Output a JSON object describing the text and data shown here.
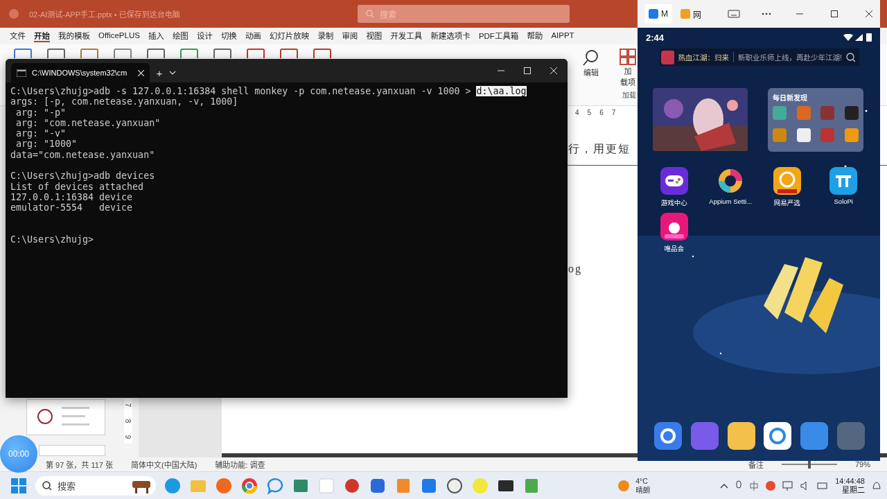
{
  "powerpoint": {
    "title": "02-AI测试-APP手工.pptx • 已保存到这台电脑",
    "search": {
      "placeholder": "搜索"
    },
    "menu": [
      {
        "label": "文件",
        "selected": false
      },
      {
        "label": "开始",
        "selected": true
      },
      {
        "label": "我的模板",
        "selected": false
      },
      {
        "label": "OfficePLUS",
        "selected": false
      },
      {
        "label": "插入",
        "selected": false
      },
      {
        "label": "绘图",
        "selected": false
      },
      {
        "label": "设计",
        "selected": false
      },
      {
        "label": "切换",
        "selected": false
      },
      {
        "label": "动画",
        "selected": false
      },
      {
        "label": "幻灯片放映",
        "selected": false
      },
      {
        "label": "录制",
        "selected": false
      },
      {
        "label": "审阅",
        "selected": false
      },
      {
        "label": "视图",
        "selected": false
      },
      {
        "label": "开发工具",
        "selected": false
      },
      {
        "label": "新建选项卡",
        "selected": false
      },
      {
        "label": "PDF工具箱",
        "selected": false
      },
      {
        "label": "帮助",
        "selected": false
      },
      {
        "label": "AIPPT",
        "selected": false
      }
    ],
    "ribbon": {
      "edit_button": "编辑",
      "addins_button": [
        "加",
        "载项"
      ],
      "group_label": "加载"
    },
    "ruler": [
      "4",
      "5",
      "6",
      "7"
    ],
    "vertical_ruler": [
      "7",
      "8",
      "9"
    ],
    "slide_texts": [
      "行，用更短",
      "og"
    ],
    "timer": "00:00",
    "status_bar": {
      "slide_count": "第 97 张，共 117 张",
      "language": "简体中文(中国大陆)",
      "accessibility": "辅助功能: 调查",
      "notes": "备注",
      "zoom": "79%",
      "zoom_slider": {
        "level": 0.5
      }
    }
  },
  "terminal": {
    "tab_title": "C:\\WINDOWS\\system32\\cm",
    "new_tab": "+",
    "lines": [
      {
        "kind": "text",
        "text": "C:\\Users\\zhujg>adb -s 127.0.0.1:16384 shell monkey -p com.netease.yanxuan -v 1000 > ",
        "selection": "d:\\aa.log"
      },
      {
        "kind": "text",
        "text": "args: [-p, com.netease.yanxuan, -v, 1000]"
      },
      {
        "kind": "text",
        "text": " arg: \"-p\""
      },
      {
        "kind": "text",
        "text": " arg: \"com.netease.yanxuan\""
      },
      {
        "kind": "text",
        "text": " arg: \"-v\""
      },
      {
        "kind": "text",
        "text": " arg: \"1000\""
      },
      {
        "kind": "text",
        "text": "data=\"com.netease.yanxuan\""
      },
      {
        "kind": "blank"
      },
      {
        "kind": "text",
        "text": "C:\\Users\\zhujg>adb devices"
      },
      {
        "kind": "text",
        "text": "List of devices attached"
      },
      {
        "kind": "text",
        "text": "127.0.0.1:16384 device"
      },
      {
        "kind": "text",
        "text": "emulator-5554   device"
      },
      {
        "kind": "blank"
      },
      {
        "kind": "blank"
      },
      {
        "kind": "text",
        "text": "C:\\Users\\zhujg>"
      }
    ]
  },
  "phone": {
    "tabs": [
      {
        "label": "M",
        "selected": true
      },
      {
        "label": "网",
        "selected": false
      }
    ],
    "time": "2:44",
    "search_bar": {
      "title": "热血江湖：归来",
      "text": "新职业乐师上线，再赴少年江湖!"
    },
    "widget_title": "每日新发现",
    "apps": [
      {
        "label": "游戏中心"
      },
      {
        "label": "Appium Setti..."
      },
      {
        "label": "网易严选"
      },
      {
        "label": "SoloPi"
      },
      {
        "label": "唯品会"
      }
    ]
  },
  "taskbar": {
    "search": {
      "placeholder": "搜索"
    },
    "weather": {
      "temperature": "4°C",
      "condition": "晴朗"
    },
    "clock": {
      "time": "14:44:48",
      "day": "星期二"
    }
  }
}
